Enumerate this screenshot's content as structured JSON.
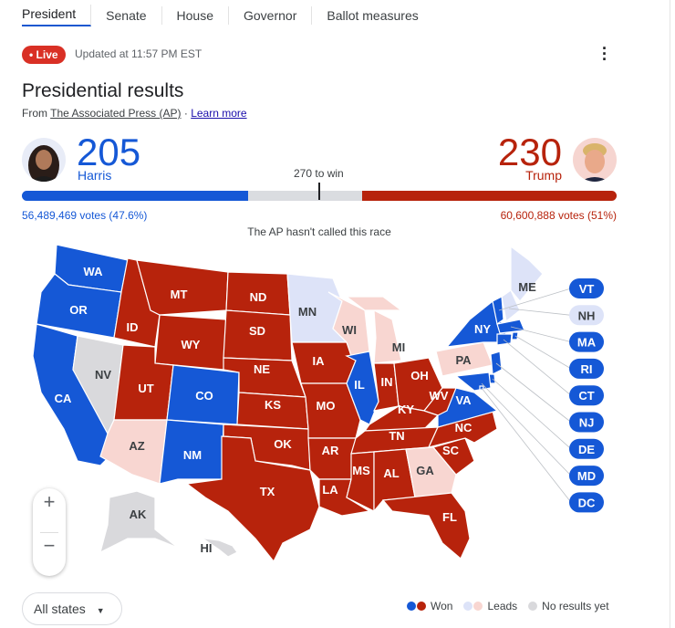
{
  "tabs": [
    {
      "label": "President",
      "active": true
    },
    {
      "label": "Senate"
    },
    {
      "label": "House"
    },
    {
      "label": "Governor"
    },
    {
      "label": "Ballot measures"
    }
  ],
  "live_label": "Live",
  "updated": "Updated at 11:57 PM EST",
  "title": "Presidential results",
  "source": {
    "prefix": "From",
    "link": "The Associated Press (AP)",
    "sep": "·",
    "learn_more": "Learn more"
  },
  "candidates": {
    "dem": {
      "name": "Harris",
      "electoral_votes": "205",
      "votes": "56,489,469 votes (47.6%)",
      "color": "#1558d6"
    },
    "rep": {
      "name": "Trump",
      "electoral_votes": "230",
      "votes": "60,600,888 votes (51%)",
      "color": "#b7230c"
    }
  },
  "to_win": "270 to win",
  "electoral_total": 538,
  "status_text": "The AP hasn't called this race",
  "colors": {
    "dem_won": "#1558d6",
    "rep_won": "#b7230c",
    "dem_leads": "#dde3f8",
    "rep_leads": "#f8d6d1",
    "none": "#d9d9dc"
  },
  "states": {
    "WA": "dem_won",
    "OR": "dem_won",
    "CA": "dem_won",
    "NV": "none",
    "ID": "rep_won",
    "MT": "rep_won",
    "WY": "rep_won",
    "UT": "rep_won",
    "CO": "dem_won",
    "AZ": "rep_leads",
    "NM": "dem_won",
    "ND": "rep_won",
    "SD": "rep_won",
    "NE": "rep_won",
    "KS": "rep_won",
    "OK": "rep_won",
    "TX": "rep_won",
    "MN": "dem_leads",
    "IA": "rep_won",
    "MO": "rep_won",
    "AR": "rep_won",
    "LA": "rep_won",
    "WI": "rep_leads",
    "IL": "dem_won",
    "MI": "rep_leads",
    "IN": "rep_won",
    "OH": "rep_won",
    "KY": "rep_won",
    "TN": "rep_won",
    "MS": "rep_won",
    "AL": "rep_won",
    "GA": "rep_leads",
    "FL": "rep_won",
    "SC": "rep_won",
    "NC": "rep_won",
    "VA": "dem_won",
    "WV": "rep_won",
    "PA": "rep_leads",
    "NY": "dem_won",
    "ME": "dem_leads",
    "VT": "dem_won",
    "NH": "dem_leads",
    "MA": "dem_won",
    "RI": "dem_won",
    "CT": "dem_won",
    "NJ": "dem_won",
    "DE": "dem_won",
    "MD": "dem_won",
    "DC": "dem_won",
    "AK": "none",
    "HI": "none"
  },
  "callouts": [
    "VT",
    "NH",
    "MA",
    "RI",
    "CT",
    "NJ",
    "DE",
    "MD",
    "DC"
  ],
  "zoom": {
    "in": "+",
    "out": "−"
  },
  "filter": {
    "selected": "All states"
  },
  "legend": {
    "won": "Won",
    "leads": "Leads",
    "none": "No results yet"
  }
}
